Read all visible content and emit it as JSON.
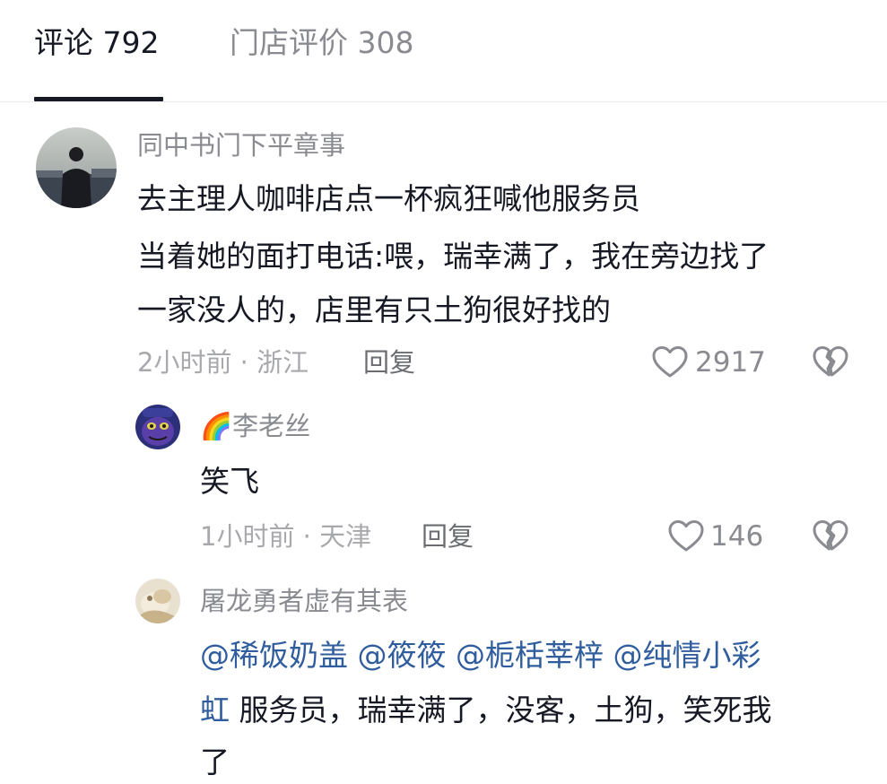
{
  "tabs": {
    "comments_label": "评论 792",
    "store_reviews_label": "门店评价 308"
  },
  "comments": [
    {
      "username": "同中书门下平章事",
      "lines": [
        "去主理人咖啡店点一杯疯狂喊他服务员",
        "当着她的面打电话:喂，瑞幸满了，我在旁边找了",
        "一家没人的，店里有只土狗很好找的"
      ],
      "meta": "2小时前 · 浙江",
      "reply_label": "回复",
      "likes": "2917"
    },
    {
      "username_emoji": "🌈",
      "username": "李老丝",
      "lines": [
        "笑飞"
      ],
      "meta": "1小时前 · 天津",
      "reply_label": "回复",
      "likes": "146"
    },
    {
      "username": "屠龙勇者虚有其表",
      "mentions_line1": [
        "@稀饭奶盖",
        "@筱筱",
        "@栀栝莘梓",
        "@纯情小彩"
      ],
      "mention_cont": "虹",
      "line2_rest": " 服务员，瑞幸满了，没客，土狗，笑死我",
      "line3": "了"
    }
  ],
  "colors": {
    "primary_text": "#161823",
    "secondary_text": "#8a8b91",
    "mention": "#2f5d9e"
  }
}
